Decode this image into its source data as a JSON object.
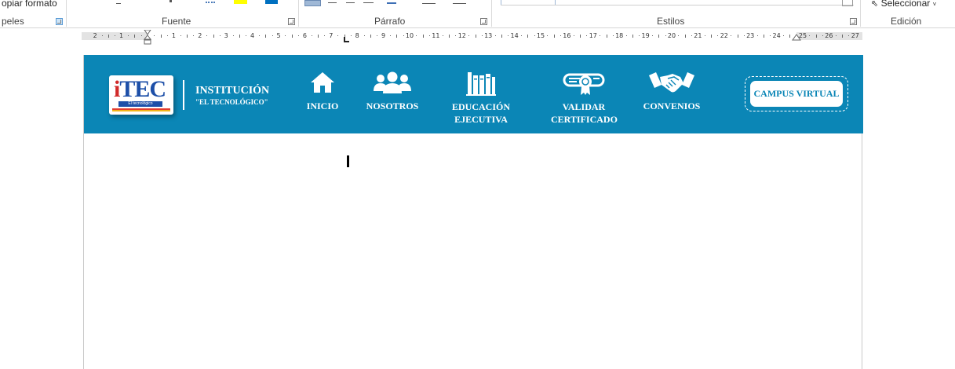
{
  "ribbon": {
    "clipboard": {
      "copy_format_label": "opiar formato",
      "group_label": "peles"
    },
    "font": {
      "group_label": "Fuente",
      "highlight_color": "#ffff00",
      "font_color": "#0070c0"
    },
    "paragraph": {
      "group_label": "Párrafo"
    },
    "styles": {
      "group_label": "Estilos"
    },
    "editing": {
      "select_label": "Seleccionar",
      "group_label": "Edición"
    }
  },
  "ruler": {
    "left_numbers": [
      "2",
      "1"
    ],
    "right_numbers": [
      "1",
      "2",
      "3",
      "4",
      "5",
      "6",
      "7",
      "8",
      "9",
      "10",
      "11",
      "12",
      "13",
      "14",
      "15",
      "16",
      "17",
      "18",
      "19",
      "20",
      "21",
      "22",
      "23",
      "24",
      "25",
      "26",
      "27"
    ]
  },
  "document": {
    "banner_color": "#0b86b6",
    "logo": {
      "text": "TEC",
      "tagline": "El tecnológico"
    },
    "institution": {
      "title": "INSTITUCIÓN",
      "subtitle": "\"EL TECNOLÓGICO\""
    },
    "nav": [
      {
        "label": "INICIO",
        "icon": "home-icon"
      },
      {
        "label": "NOSOTROS",
        "icon": "users-icon"
      },
      {
        "label_line1": "EDUCACIÓN",
        "label_line2": "EJECUTIVA",
        "icon": "books-icon"
      },
      {
        "label_line1": "VALIDAR",
        "label_line2": "CERTIFICADO",
        "icon": "certificate-icon"
      },
      {
        "label": "CONVENIOS",
        "icon": "handshake-icon"
      }
    ],
    "campus_button": "CAMPUS VIRTUAL"
  }
}
